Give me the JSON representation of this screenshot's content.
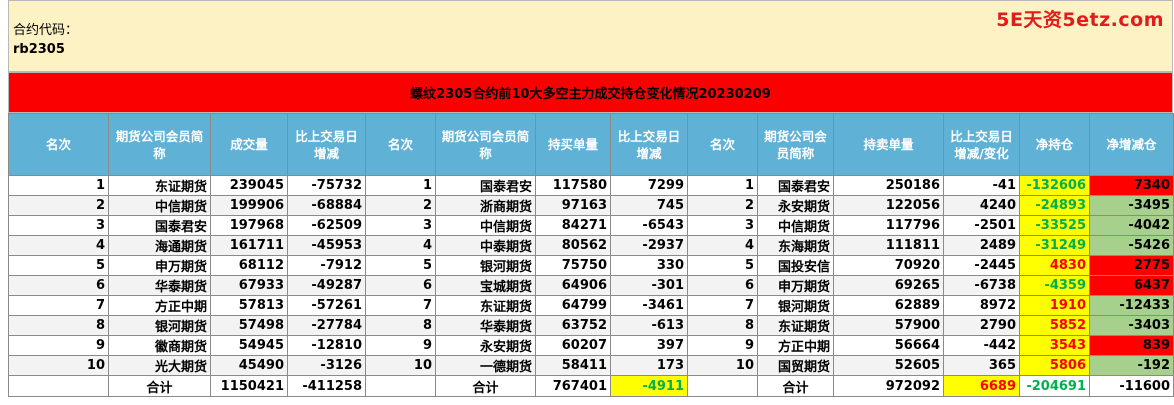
{
  "contract_label": "合约代码：",
  "contract_code": "rb2305",
  "watermark": "5E天资5etz.com",
  "title": "螺纹2305合约前10大多空主力成交持仓变化情况20230209",
  "headers": [
    "名次",
    "期货公司会员简称",
    "成交量",
    "比上交易日增减",
    "名次",
    "期货公司会员简称",
    "持买单量",
    "比上交易日增减",
    "名次",
    "期货公司会员简称",
    "持卖单量",
    "比上交易日增减/变化",
    "净持仓",
    "净增减仓"
  ],
  "rows": [
    {
      "r1": "1",
      "n1": "东证期货",
      "vol": "239045",
      "vchg": "-75732",
      "r2": "1",
      "n2": "国泰君安",
      "buy": "117580",
      "bchg": "7299",
      "r3": "1",
      "n3": "国泰君安",
      "sell": "250186",
      "schg": "-41",
      "net": "-132606",
      "netchg": "7340"
    },
    {
      "r1": "2",
      "n1": "中信期货",
      "vol": "199906",
      "vchg": "-68884",
      "r2": "2",
      "n2": "浙商期货",
      "buy": "97163",
      "bchg": "745",
      "r3": "2",
      "n3": "永安期货",
      "sell": "122056",
      "schg": "4240",
      "net": "-24893",
      "netchg": "-3495"
    },
    {
      "r1": "3",
      "n1": "国泰君安",
      "vol": "197968",
      "vchg": "-62509",
      "r2": "3",
      "n2": "中信期货",
      "buy": "84271",
      "bchg": "-6543",
      "r3": "3",
      "n3": "中信期货",
      "sell": "117796",
      "schg": "-2501",
      "net": "-33525",
      "netchg": "-4042"
    },
    {
      "r1": "4",
      "n1": "海通期货",
      "vol": "161711",
      "vchg": "-45953",
      "r2": "4",
      "n2": "中泰期货",
      "buy": "80562",
      "bchg": "-2937",
      "r3": "4",
      "n3": "东海期货",
      "sell": "111811",
      "schg": "2489",
      "net": "-31249",
      "netchg": "-5426"
    },
    {
      "r1": "5",
      "n1": "申万期货",
      "vol": "68112",
      "vchg": "-7912",
      "r2": "5",
      "n2": "银河期货",
      "buy": "75750",
      "bchg": "330",
      "r3": "5",
      "n3": "国投安信",
      "sell": "70920",
      "schg": "-2445",
      "net": "4830",
      "netchg": "2775"
    },
    {
      "r1": "6",
      "n1": "华泰期货",
      "vol": "67933",
      "vchg": "-49287",
      "r2": "6",
      "n2": "宝城期货",
      "buy": "64906",
      "bchg": "-301",
      "r3": "6",
      "n3": "申万期货",
      "sell": "69265",
      "schg": "-6738",
      "net": "-4359",
      "netchg": "6437"
    },
    {
      "r1": "7",
      "n1": "方正中期",
      "vol": "57813",
      "vchg": "-57261",
      "r2": "7",
      "n2": "东证期货",
      "buy": "64799",
      "bchg": "-3461",
      "r3": "7",
      "n3": "银河期货",
      "sell": "62889",
      "schg": "8972",
      "net": "1910",
      "netchg": "-12433"
    },
    {
      "r1": "8",
      "n1": "银河期货",
      "vol": "57498",
      "vchg": "-27784",
      "r2": "8",
      "n2": "华泰期货",
      "buy": "63752",
      "bchg": "-613",
      "r3": "8",
      "n3": "东证期货",
      "sell": "57900",
      "schg": "2790",
      "net": "5852",
      "netchg": "-3403"
    },
    {
      "r1": "9",
      "n1": "徽商期货",
      "vol": "54945",
      "vchg": "-12810",
      "r2": "9",
      "n2": "永安期货",
      "buy": "60207",
      "bchg": "397",
      "r3": "9",
      "n3": "方正中期",
      "sell": "56664",
      "schg": "-442",
      "net": "3543",
      "netchg": "839"
    },
    {
      "r1": "10",
      "n1": "光大期货",
      "vol": "45490",
      "vchg": "-3126",
      "r2": "10",
      "n2": "一德期货",
      "buy": "58411",
      "bchg": "173",
      "r3": "10",
      "n3": "国贸期货",
      "sell": "52605",
      "schg": "365",
      "net": "5806",
      "netchg": "-192"
    }
  ],
  "totals": {
    "label1": "合计",
    "vol": "1150421",
    "vchg": "-411258",
    "label2": "合计",
    "buy": "767401",
    "bchg": "-4911",
    "label3": "合计",
    "sell": "972092",
    "schg": "6689",
    "net": "-204691",
    "netchg": "-11600"
  },
  "colors": {
    "title_bg": "#fa0000",
    "header_bg": "#5fb1d6",
    "info_bg": "#fdf2c4",
    "highlight_yellow": "#ffff00",
    "highlight_green": "#a8d08d",
    "highlight_red": "#ff0000",
    "text_green": "#00b050",
    "text_red": "#ff0000"
  }
}
